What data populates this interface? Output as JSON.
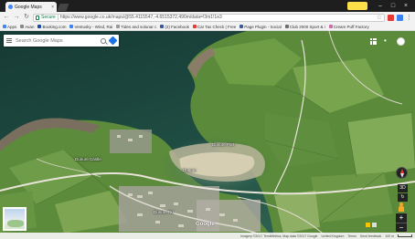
{
  "browser": {
    "tab_title": "Google Maps",
    "tab_close": "×",
    "url": "https://www.google.co.uk/maps/@55.4115547,-4.6515372,490m/data=!3m1!1e3",
    "secure_label": "Secure",
    "window_controls": [
      "–",
      "□",
      "×"
    ]
  },
  "bookmarks": [
    {
      "label": "Apps",
      "color": "#4285f4"
    },
    {
      "label": "Avan",
      "color": "#888888"
    },
    {
      "label": "Booking.com",
      "color": "#1a4aa0"
    },
    {
      "label": "Ventusky - Wind, Rai",
      "color": "#3b82f6"
    },
    {
      "label": "Tides and solunar c",
      "color": "#999999"
    },
    {
      "label": "(2) Facebook",
      "color": "#3b5998"
    },
    {
      "label": "Car Tax Check | Free",
      "color": "#e53935"
    },
    {
      "label": "Page Plugin - Social",
      "color": "#3b5998"
    },
    {
      "label": "Club 2000 Sport & i",
      "color": "#6d6d6d"
    },
    {
      "label": "Cream Puff Factory",
      "color": "#d16ba5"
    }
  ],
  "search": {
    "placeholder": "Search Google Maps"
  },
  "places": [
    {
      "label": "Dunure Castle"
    },
    {
      "label": "Dunure Port"
    },
    {
      "label": "Dunure"
    },
    {
      "label": "Dunure Rd"
    }
  ],
  "map": {
    "zoom_in": "+",
    "zoom_out": "−",
    "view_3d": "3D",
    "logo": "Google",
    "footer_items": [
      "Imagery ©2017 TerraMetrics, Map data ©2017 Google",
      "United Kingdom",
      "Terms",
      "Send feedback",
      "100 m"
    ]
  },
  "colors": {
    "sea": "#1e4a3e",
    "land": "#5d8c3c",
    "road": "#e8e4da",
    "accent": "#4285f4"
  }
}
